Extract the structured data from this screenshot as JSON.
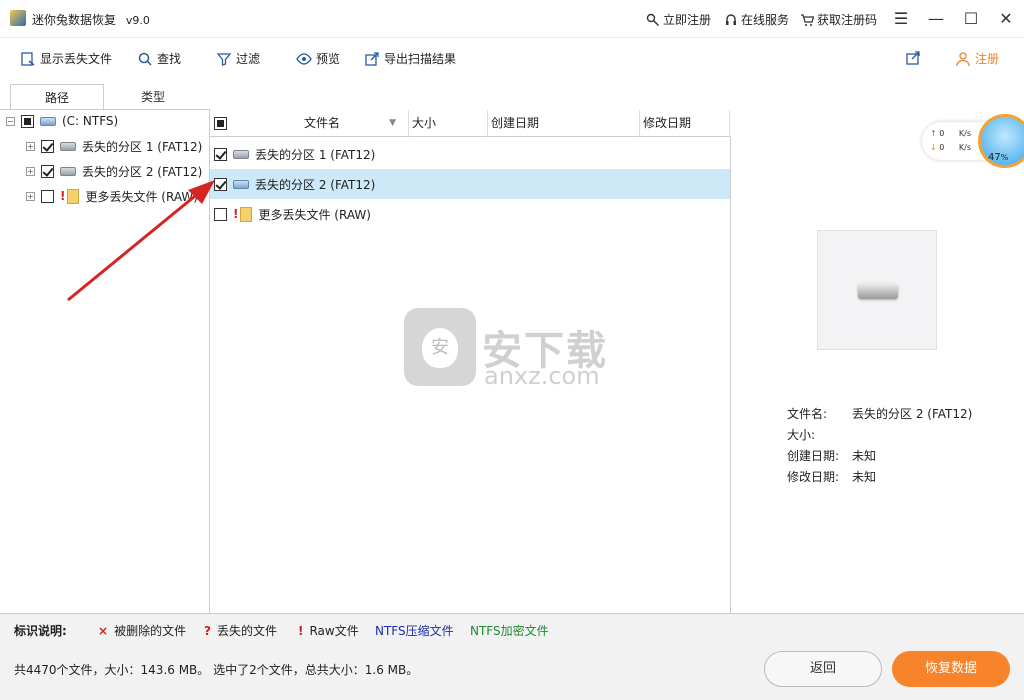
{
  "window": {
    "title": "迷你兔数据恢复",
    "version": "v9.0",
    "links": {
      "register_now": "立即注册",
      "online_service": "在线服务",
      "get_code": "获取注册码"
    }
  },
  "toolbar": {
    "show_lost": "显示丢失文件",
    "find": "查找",
    "filter": "过滤",
    "preview": "预览",
    "export": "导出扫描结果",
    "register": "注册"
  },
  "tabs": [
    {
      "label": "路径"
    },
    {
      "label": "类型"
    }
  ],
  "tree": {
    "root": "(C: NTFS)",
    "items": [
      {
        "label": "丢失的分区 1 (FAT12)"
      },
      {
        "label": "丢失的分区 2 (FAT12)"
      },
      {
        "label": "更多丢失文件 (RAW)"
      }
    ]
  },
  "table": {
    "columns": [
      "文件名",
      "大小",
      "创建日期",
      "修改日期"
    ],
    "rows": [
      {
        "name": "丢失的分区 1 (FAT12)"
      },
      {
        "name": "丢失的分区 2 (FAT12)"
      },
      {
        "name": "更多丢失文件 (RAW)"
      }
    ]
  },
  "preview": {
    "filename_label": "文件名:",
    "filename_value": "丢失的分区 2 (FAT12)",
    "size_label": "大小:",
    "created_label": "创建日期:",
    "created_value": "未知",
    "modified_label": "修改日期:",
    "modified_value": "未知"
  },
  "speed_widget": {
    "up": "0",
    "down": "0",
    "unit": "K/s",
    "percent": "47",
    "percent_sign": "%"
  },
  "watermark": {
    "text1": "安下载",
    "text2": "anxz.com",
    "glyph": "安"
  },
  "legend": {
    "title": "标识说明:",
    "deleted": "被删除的文件",
    "lost": "丢失的文件",
    "raw": "Raw文件",
    "ntfs_compressed": "NTFS压缩文件",
    "ntfs_encrypted": "NTFS加密文件"
  },
  "status": {
    "text": "共4470个文件，大小：143.6 MB。 选中了2个文件，总共大小：1.6 MB。",
    "back": "返回",
    "recover": "恢复数据"
  },
  "colors": {
    "accent": "#f7842a",
    "selected_row": "#cde8f7",
    "ntfs_compressed": "#1a2ea6",
    "ntfs_encrypted": "#1f8a2e",
    "deleted_mark": "#d51e1e"
  }
}
